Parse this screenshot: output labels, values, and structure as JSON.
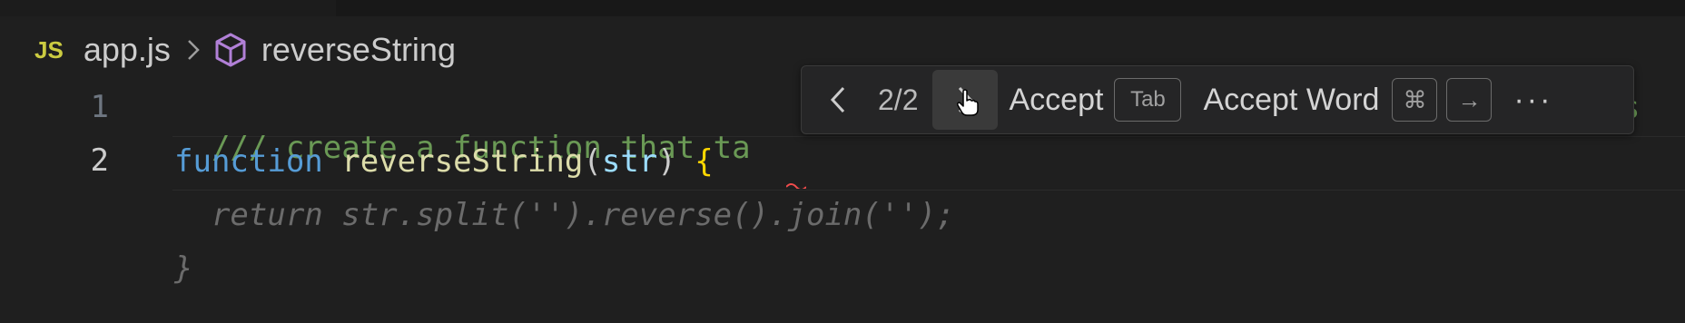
{
  "breadcrumb": {
    "file_badge": "JS",
    "file_name": "app.js",
    "separator_icon": "chevron-right-icon",
    "symbol_icon": "symbol-method-icon",
    "symbol_name": "reverseString"
  },
  "editor": {
    "line_numbers": [
      "1",
      "2"
    ],
    "line1_comment": "/// create a function that ta",
    "line1_tail": "s",
    "line2": {
      "keyword": "function",
      "name": "reverseString",
      "open_paren": "(",
      "param": "str",
      "close_paren": ")",
      "brace": "{"
    },
    "ghost_line1": "  return str.split('').reverse().join('');",
    "ghost_line2": "}"
  },
  "suggestion_toolbar": {
    "prev_icon": "chevron-left-icon",
    "counter": "2/2",
    "next_icon": "chevron-right-icon",
    "accept_label": "Accept",
    "accept_key": "Tab",
    "accept_word_label": "Accept Word",
    "accept_word_key_cmd": "⌘",
    "accept_word_key_arrow": "→",
    "more_icon": "ellipsis-icon",
    "more_label": "···"
  },
  "colors": {
    "background": "#1f1f1f",
    "comment": "#6a9955",
    "keyword": "#569cd6",
    "function": "#dcdcaa",
    "param": "#9cdcfe",
    "brace": "#ffd700",
    "ghost_text": "#6b6b6b",
    "js_badge": "#cbcb41",
    "symbol_icon": "#b180d7"
  }
}
